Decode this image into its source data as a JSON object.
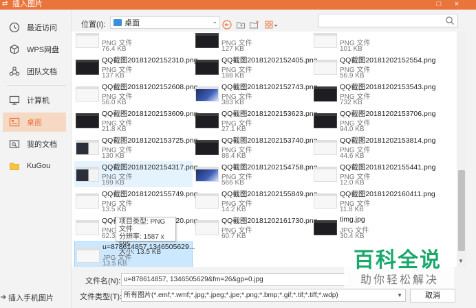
{
  "window": {
    "title": "插入图片",
    "buttons": [
      "□",
      "×"
    ]
  },
  "sidebar": {
    "items": [
      {
        "label": "最近访问",
        "icon": "clock-icon"
      },
      {
        "label": "WPS网盘",
        "icon": "cube-icon"
      },
      {
        "label": "团队文档",
        "icon": "team-icon"
      },
      {
        "label": "计算机",
        "icon": "computer-icon"
      },
      {
        "label": "桌面",
        "icon": "desktop-icon",
        "active": true
      },
      {
        "label": "我的文档",
        "icon": "documents-icon"
      },
      {
        "label": "KuGou",
        "icon": "folder-icon"
      }
    ],
    "bottom_link": "插入手机图片"
  },
  "toolbar": {
    "location_label": "位置(I):",
    "location_value": "桌面",
    "search_placeholder": ""
  },
  "files": [
    {
      "name": "",
      "type": "PNG 文件",
      "size": "76.4 KB",
      "thumb": "white"
    },
    {
      "name": "",
      "type": "PNG 文件",
      "size": "127 KB",
      "thumb": "dark"
    },
    {
      "name": "",
      "type": "PNG 文件",
      "size": "101 KB",
      "thumb": "white"
    },
    {
      "name": "QQ截图20181202152310.png",
      "type": "PNG 文件",
      "size": "137 KB",
      "thumb": "dark"
    },
    {
      "name": "QQ截图20181202152405.png",
      "type": "PNG 文件",
      "size": "188 KB",
      "thumb": "dark"
    },
    {
      "name": "QQ截图20181202152554.png",
      "type": "PNG 文件",
      "size": "56.9 KB",
      "thumb": "white"
    },
    {
      "name": "QQ截图20181202152608.png",
      "type": "PNG 文件",
      "size": "56.0 KB",
      "thumb": "white"
    },
    {
      "name": "QQ截图20181202152743.png",
      "type": "PNG 文件",
      "size": "383 KB",
      "thumb": "blue"
    },
    {
      "name": "QQ截图20181202153543.png",
      "type": "PNG 文件",
      "size": "732 KB",
      "thumb": "dark"
    },
    {
      "name": "QQ截图20181202153609.png",
      "type": "PNG 文件",
      "size": "21.8 KB",
      "thumb": "dark"
    },
    {
      "name": "QQ截图20181202153623.png",
      "type": "PNG 文件",
      "size": "27.1 KB",
      "thumb": "dark"
    },
    {
      "name": "QQ截图20181202153706.png",
      "type": "PNG 文件",
      "size": "94.0 KB",
      "thumb": "dark"
    },
    {
      "name": "QQ截图20181202153725.png",
      "type": "PNG 文件",
      "size": "130 KB",
      "thumb": "mix"
    },
    {
      "name": "QQ截图20181202153740.png",
      "type": "PNG 文件",
      "size": "88.4 KB",
      "thumb": "dark"
    },
    {
      "name": "QQ截图20181202153814.png",
      "type": "PNG 文件",
      "size": "44.6 KB",
      "thumb": "white"
    },
    {
      "name": "QQ截图20181202154317.png",
      "type": "PNG 文件",
      "size": "199 KB",
      "thumb": "mix",
      "hover": true
    },
    {
      "name": "QQ截图20181202154758.png",
      "type": "PNG 文件",
      "size": "566 KB",
      "thumb": "blue"
    },
    {
      "name": "QQ截图20181202155441.png",
      "type": "PNG 文件",
      "size": "12.0 KB",
      "thumb": "white"
    },
    {
      "name": "QQ截图20181202155749.png",
      "type": "PNG 文件",
      "size": "13.5 KB",
      "thumb": "white"
    },
    {
      "name": "QQ截图20181202155849.png",
      "type": "PNG 文件",
      "size": "14.2 KB",
      "thumb": "white"
    },
    {
      "name": "QQ截图20181202160411.png",
      "type": "PNG 文件",
      "size": "11.8 KB",
      "thumb": "white"
    },
    {
      "name": "QQ截图20181202161720.png",
      "type": "PNG 文件",
      "size": "62.3 KB",
      "thumb": "white"
    },
    {
      "name": "QQ截图20181202161730.png",
      "type": "PNG 文件",
      "size": "60.7 KB",
      "thumb": "white"
    },
    {
      "name": "timg.jpg",
      "type": "JPG 文件",
      "size": "30.4 KB",
      "thumb": "dark"
    },
    {
      "name": "u=878614857,1346505629...",
      "type": "JPG 文件",
      "size": "13.5 KB",
      "thumb": "white",
      "selected": true
    }
  ],
  "tooltip": {
    "line1": "项目类型: PNG 文件",
    "line2": "分辨率: 1587 x 595",
    "line3": "大小: 13.5 KB"
  },
  "footer": {
    "filename_label": "文件名(N):",
    "filename_value": "u=878614857, 1346505629&fm=26&gp=0.jpg",
    "filetype_label": "文件类型(T):",
    "filetype_value": "所有图片(*.emf;*.wmf;*.jpg;*.jpeg;*.jpe;*.png;*.bmp;*.gif;*.tif;*.tiff;*.wdp)",
    "cancel_label": "取消"
  },
  "watermark": {
    "main": "百科全说",
    "sub": "助你轻松解决"
  },
  "colors": {
    "accent": "#e9743c",
    "sidebar_active": "#f6d9c4",
    "selection": "#cce8ff",
    "watermark_green": "#1aa86b"
  }
}
